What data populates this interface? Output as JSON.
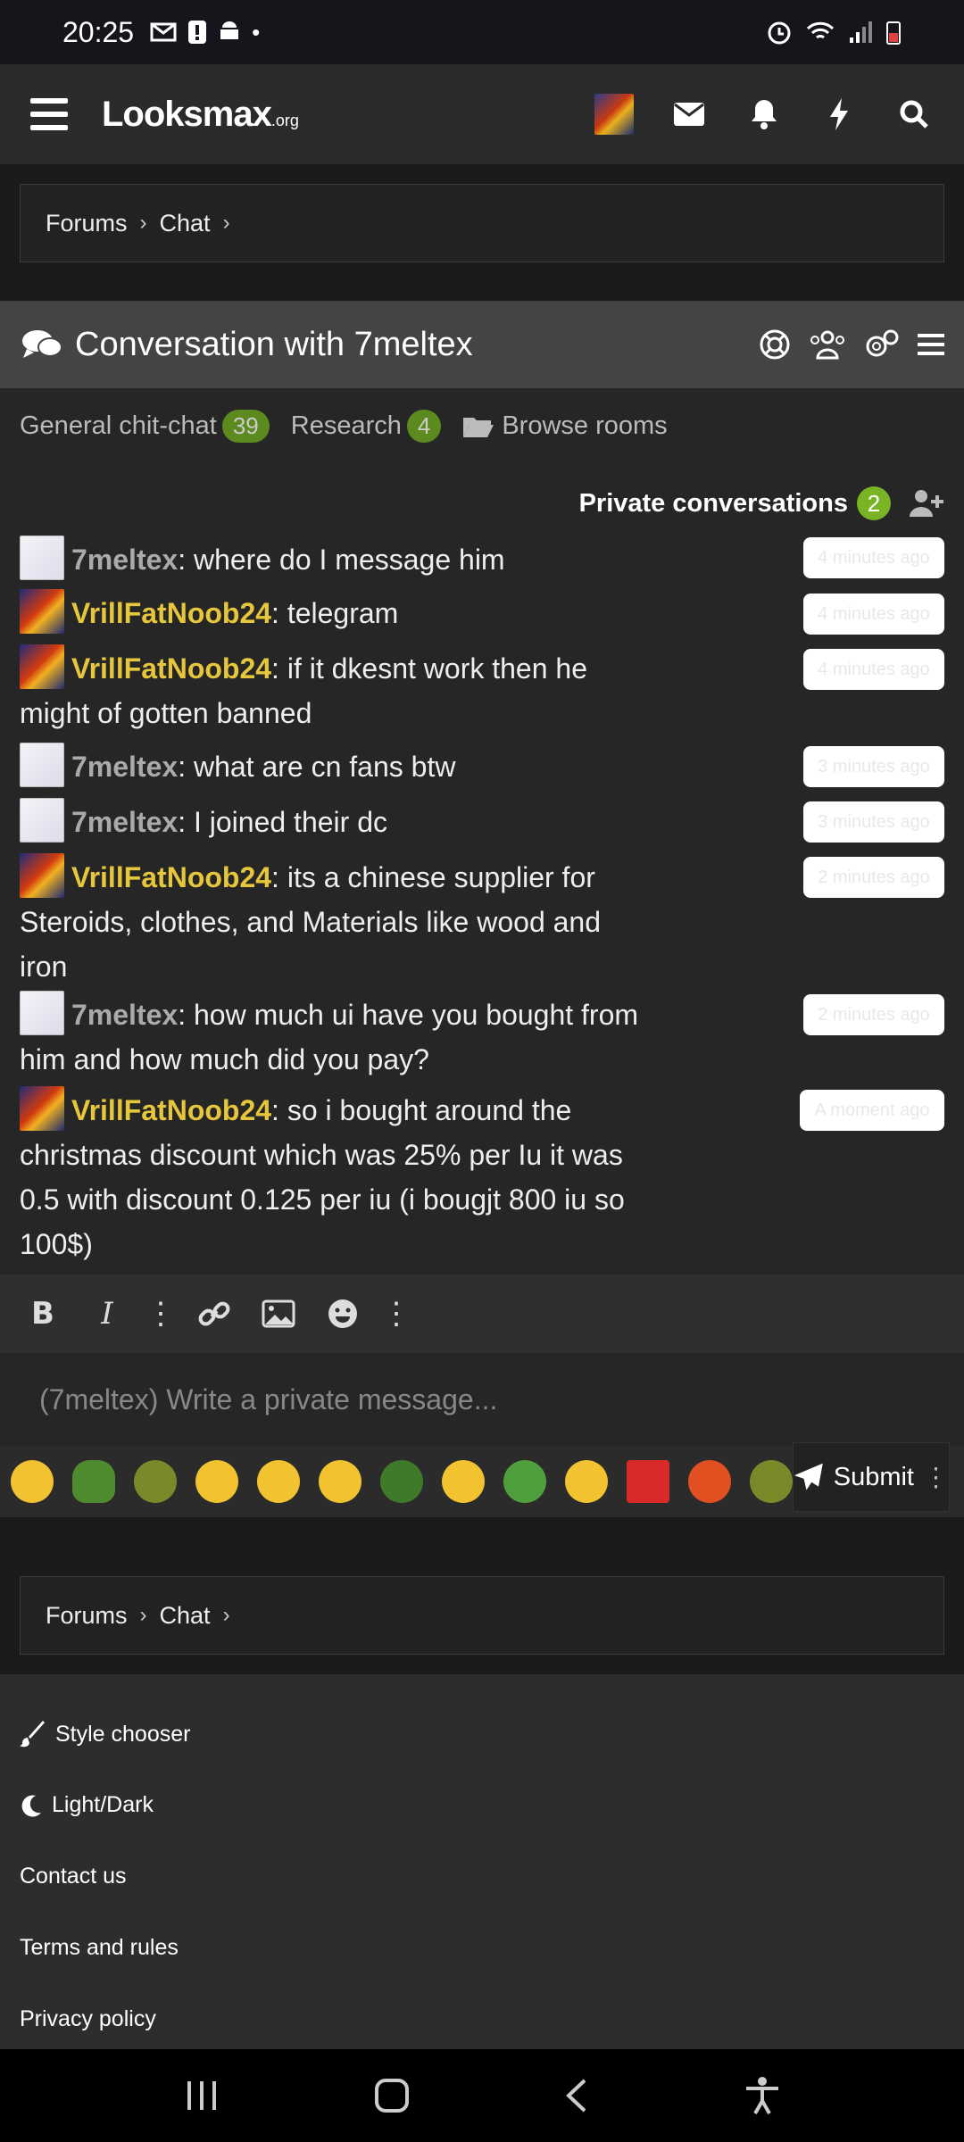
{
  "status_bar": {
    "time": "20:25"
  },
  "header": {
    "logo_main": "Looksmax",
    "logo_suffix": ".org"
  },
  "breadcrumb_top": {
    "items": [
      "Forums",
      "Chat"
    ]
  },
  "conversation": {
    "title": "Conversation with 7meltex"
  },
  "rooms": [
    {
      "label": "General chit-chat",
      "count": "39"
    },
    {
      "label": "Research",
      "count": "4"
    },
    {
      "label": "Browse rooms"
    }
  ],
  "private_conversations": {
    "label": "Private conversations",
    "count": "2"
  },
  "messages": [
    {
      "user": "7meltex",
      "text": ": where do I message him",
      "time": "4 minutes ago"
    },
    {
      "user": "VrillFatNoob24",
      "text": ": telegram",
      "time": "4 minutes ago"
    },
    {
      "user": "VrillFatNoob24",
      "text": ": if it dkesnt work then he might of gotten banned",
      "time": "4 minutes ago"
    },
    {
      "user": "7meltex",
      "text": ": what are cn fans btw",
      "time": "3 minutes ago"
    },
    {
      "user": "7meltex",
      "text": ": I joined their dc",
      "time": "3 minutes ago"
    },
    {
      "user": "VrillFatNoob24",
      "text": ": its a chinese supplier for Steroids, clothes, and Materials like wood and iron",
      "time": "2 minutes ago"
    },
    {
      "user": "7meltex",
      "text": ": how much ui have you bought from him and how much did you pay?",
      "time": "2 minutes ago"
    },
    {
      "user": "VrillFatNoob24",
      "text": ": so i bought around the christmas discount which was 25% per Iu it was 0.5 with discount 0.125 per iu (i bougjt 800 iu so 100$)",
      "time": "A moment ago"
    }
  ],
  "editor": {
    "placeholder": "(7meltex) Write a private message...",
    "submit_label": "Submit"
  },
  "breadcrumb_bottom": {
    "items": [
      "Forums",
      "Chat"
    ]
  },
  "footer_links": [
    "Style chooser",
    "Light/Dark",
    "Contact us",
    "Terms and rules",
    "Privacy policy"
  ],
  "colors": {
    "accent_badge": "#5c8a1f",
    "private_badge": "#78b424",
    "username_highlight": "#e6c63a"
  }
}
